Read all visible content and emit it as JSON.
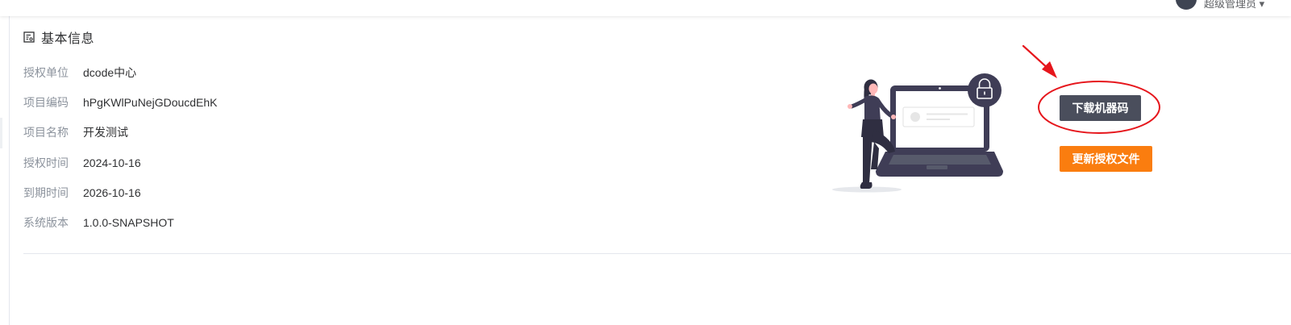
{
  "topbar": {
    "user_text": "超级管理员 ▾"
  },
  "section": {
    "title": "基本信息",
    "icon": "document-info-icon"
  },
  "info": [
    {
      "label": "授权单位",
      "value": "dcode中心"
    },
    {
      "label": "项目编码",
      "value": "hPgKWlPuNejGDoucdEhK"
    },
    {
      "label": "项目名称",
      "value": "开发测试"
    },
    {
      "label": "授权时间",
      "value": "2024-10-16"
    },
    {
      "label": "到期时间",
      "value": "2026-10-16"
    },
    {
      "label": "系统版本",
      "value": "1.0.0-SNAPSHOT"
    }
  ],
  "actions": {
    "download_label": "下载机器码",
    "update_label": "更新授权文件"
  },
  "colors": {
    "dark_button": "#4a4e5c",
    "orange_button": "#fa7d0f",
    "annotation_red": "#e6161c"
  }
}
